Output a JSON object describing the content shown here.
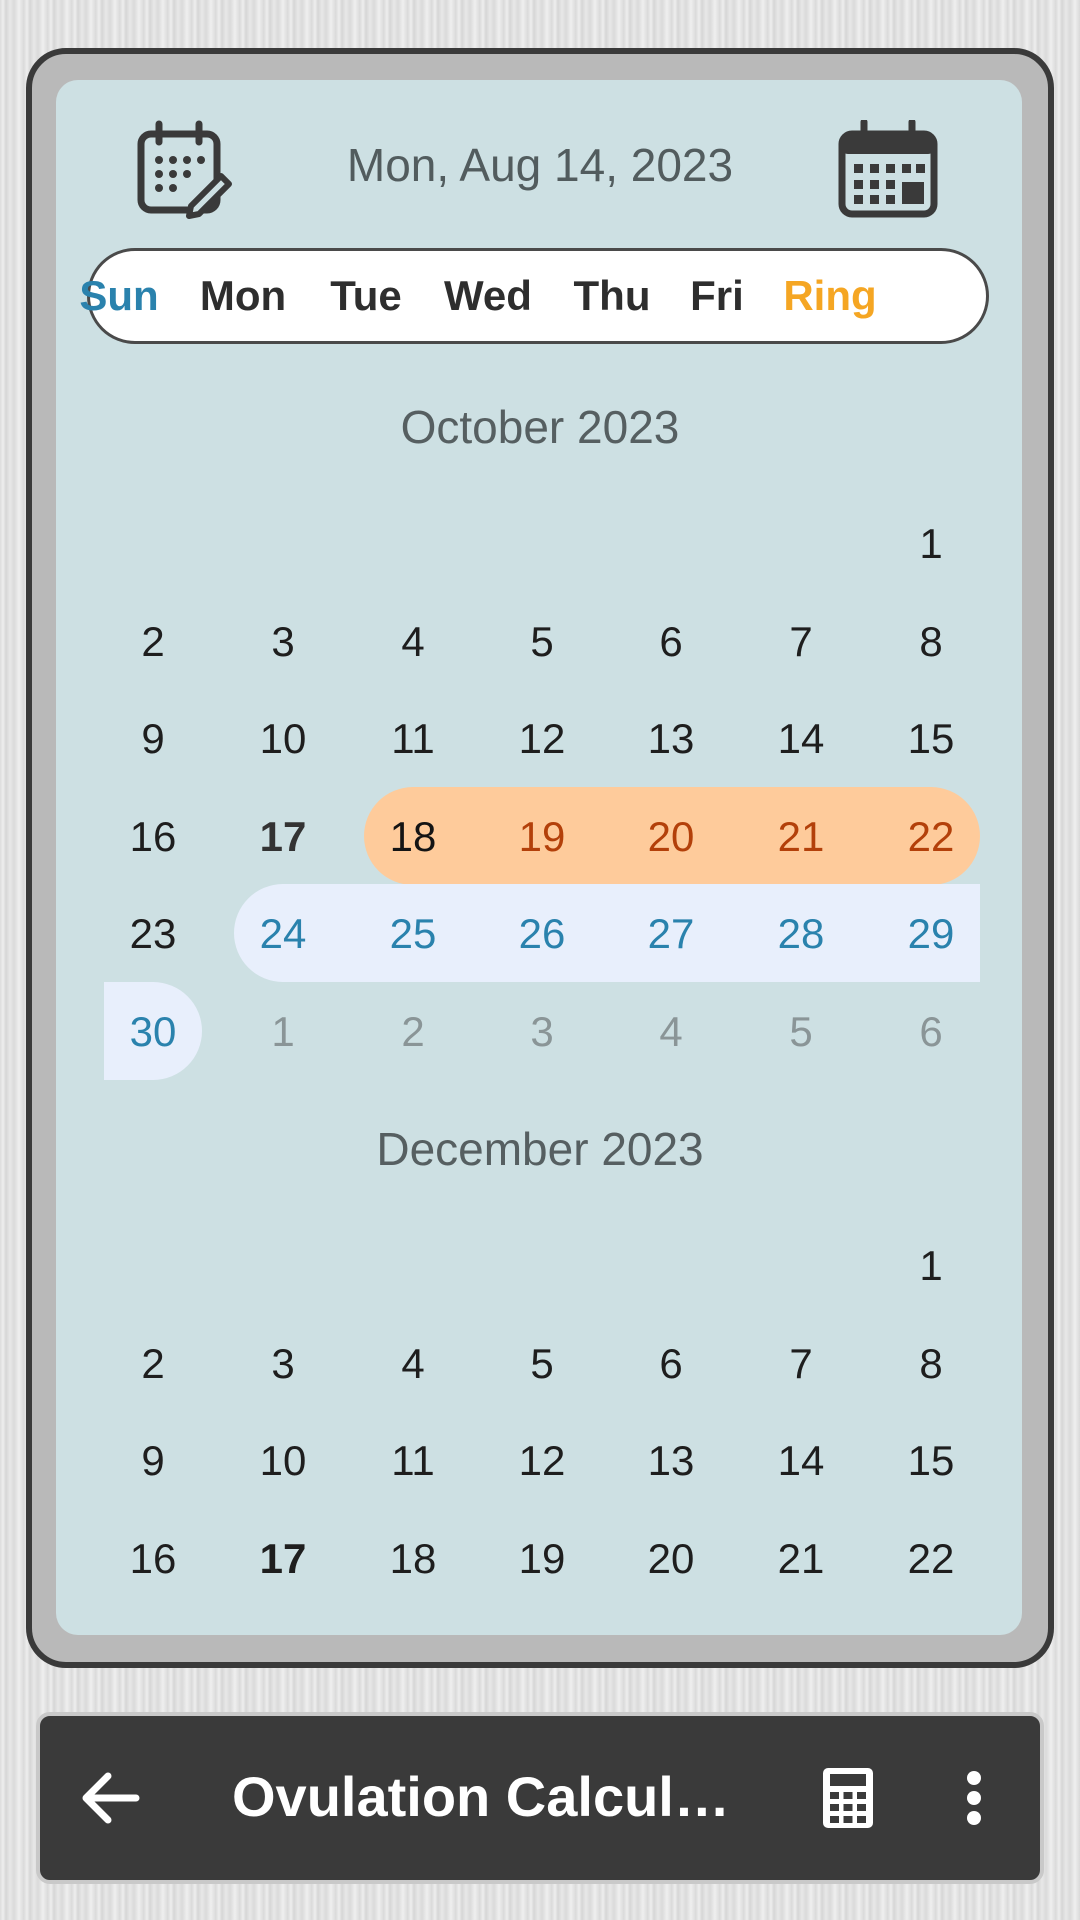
{
  "header": {
    "date": "Mon, Aug 14, 2023",
    "left_icon": "calendar-edit-icon",
    "right_icon": "calendar-icon"
  },
  "weekdays": [
    "Sun",
    "Mon",
    "Tue",
    "Wed",
    "Thu",
    "Fri",
    "Ring"
  ],
  "colors": {
    "sunday": "#2a82ad",
    "ring": "#f5a623",
    "period_band": "#fecb9b",
    "fertile_band": "#e8effc",
    "panel": "#cde0e3"
  },
  "months": [
    {
      "title": "October 2023",
      "rows": [
        [
          "",
          "",
          "",
          "",
          "",
          "",
          "1"
        ],
        [
          "2",
          "3",
          "4",
          "5",
          "6",
          "7",
          "8"
        ],
        [
          "9",
          "10",
          "11",
          "12",
          "13",
          "14",
          "15"
        ],
        [
          "16",
          "17",
          "18",
          "19",
          "20",
          "21",
          "22"
        ],
        [
          "23",
          "24",
          "25",
          "26",
          "27",
          "28",
          "29"
        ],
        [
          "30",
          "1",
          "2",
          "3",
          "4",
          "5",
          "6"
        ]
      ]
    },
    {
      "title": "December 2023",
      "rows": [
        [
          "",
          "",
          "",
          "",
          "",
          "",
          "1"
        ],
        [
          "2",
          "3",
          "4",
          "5",
          "6",
          "7",
          "8"
        ],
        [
          "9",
          "10",
          "11",
          "12",
          "13",
          "14",
          "15"
        ],
        [
          "16",
          "17",
          "18",
          "19",
          "20",
          "21",
          "22"
        ]
      ]
    }
  ],
  "appbar": {
    "title": "Ovulation Calcul…",
    "back_icon": "arrow-back-icon",
    "calculator_icon": "calculator-icon",
    "more_icon": "more-vertical-icon"
  }
}
